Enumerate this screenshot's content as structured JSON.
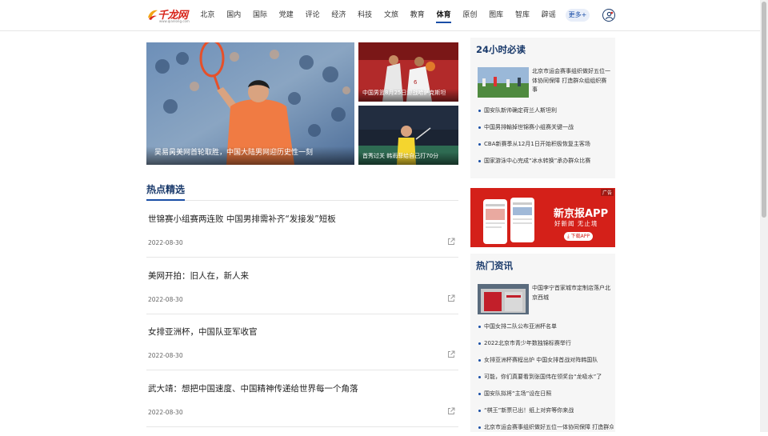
{
  "header": {
    "logo_text": "千龙网",
    "logo_sub": "www.qianlong.com",
    "nav": [
      "北京",
      "国内",
      "国际",
      "党建",
      "评论",
      "经济",
      "科技",
      "文旅",
      "教育",
      "体育",
      "原创",
      "图库",
      "智库",
      "辟谣"
    ],
    "active_nav": "体育",
    "more_label": "更多+",
    "user_icon": "user-icon"
  },
  "hero": {
    "main_caption": "吴易昺美网首轮取胜，中国大陆男网迎历史性一刻",
    "small1_caption": "中国男篮8月25日迎战哈萨克斯坦",
    "small2_caption": "首秀过关 韩雨菲给自己打70分"
  },
  "hot": {
    "title": "热点精选",
    "share_icon": "share-icon",
    "articles": [
      {
        "title": "世锦赛小组赛两连败 中国男排需补齐“发接发”短板",
        "date": "2022-08-30"
      },
      {
        "title": "美网开拍：旧人在，新人来",
        "date": "2022-08-30"
      },
      {
        "title": "女排亚洲杯，中国队亚军收官",
        "date": "2022-08-30"
      },
      {
        "title": "武大靖：想把中国速度、中国精神传递给世界每一个角落",
        "date": "2022-08-30"
      }
    ]
  },
  "read24": {
    "title": "24小时必读",
    "featured": "北京市运会赛事组织做好五位一体协同保障 打造群众参与的体育盛会组织做好五位一体协同保障 打造群众组组织赛事",
    "featured_display": "北京市运会赛事组织做好五位一体协同保障 打造群众组组织赛事",
    "items": [
      "国安队新帅确定荷兰人斯坦利",
      "中国男排輸掉世锦赛小组赛关键一战",
      "CBA新赛季从12月1日开始积极恢复主客场",
      "国家游泳中心完成“冰水转换”承办群众比赛"
    ]
  },
  "ad": {
    "badge": "广告",
    "title": "新京报APP",
    "subtitle": "好新闻 无止境",
    "button": "下载APP"
  },
  "hotnews": {
    "title": "热门资讯",
    "featured": "中国李宁首家城市定制店落户北京西城",
    "items": [
      "中国女排二队公布亚洲杯名单",
      "2022北京市青少年数独锦标赛举行",
      "女排亚洲杯赛程出炉 中国女排首战对阵韩国队",
      "可能，你们真要看到张国伟在领奖台“龙吸水”了",
      "国安队拟将“主场”设在日照",
      "“棋王”新票已出！纸上对弈等你来战",
      "北京市运会赛事组织做好五位一体协同保障 打造群众参与的体育盛会"
    ]
  },
  "colors": {
    "brand_blue": "#1a4ea6",
    "title_navy": "#1a3a6b",
    "logo_red": "#d8261c",
    "ad_red": "#d42019"
  }
}
